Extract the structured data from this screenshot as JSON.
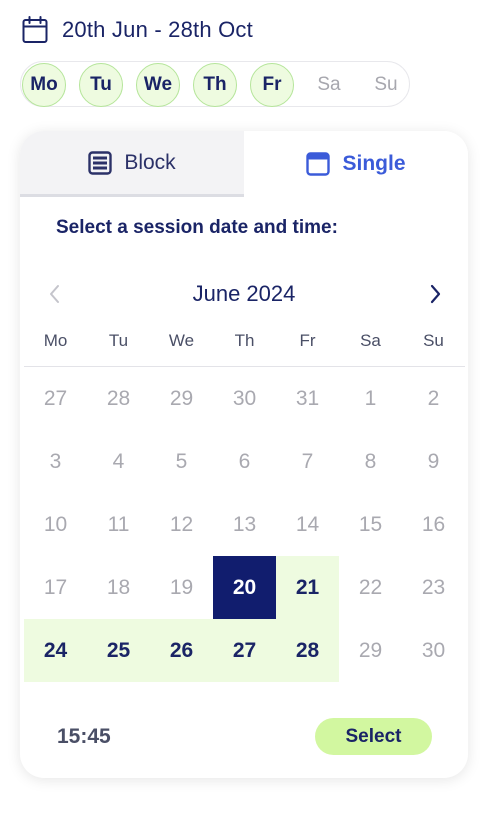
{
  "header": {
    "date_range": "20th Jun - 28th Oct",
    "icon": "calendar-icon"
  },
  "weekday_filter": [
    {
      "label": "Mo",
      "active": true
    },
    {
      "label": "Tu",
      "active": true
    },
    {
      "label": "We",
      "active": true
    },
    {
      "label": "Th",
      "active": true
    },
    {
      "label": "Fr",
      "active": true
    },
    {
      "label": "Sa",
      "active": false
    },
    {
      "label": "Su",
      "active": false
    }
  ],
  "tabs": {
    "block": {
      "label": "Block",
      "icon": "block-list-icon"
    },
    "single": {
      "label": "Single",
      "icon": "single-window-icon",
      "selected": true
    }
  },
  "instruction": "Select a session date and time:",
  "calendar": {
    "month": "June 2024",
    "weekdays": [
      "Mo",
      "Tu",
      "We",
      "Th",
      "Fr",
      "Sa",
      "Su"
    ],
    "weeks": [
      [
        {
          "d": "27",
          "s": "muted"
        },
        {
          "d": "28",
          "s": "muted"
        },
        {
          "d": "29",
          "s": "muted"
        },
        {
          "d": "30",
          "s": "muted"
        },
        {
          "d": "31",
          "s": "muted"
        },
        {
          "d": "1",
          "s": "muted"
        },
        {
          "d": "2",
          "s": "muted"
        }
      ],
      [
        {
          "d": "3",
          "s": "muted"
        },
        {
          "d": "4",
          "s": "muted"
        },
        {
          "d": "5",
          "s": "muted"
        },
        {
          "d": "6",
          "s": "muted"
        },
        {
          "d": "7",
          "s": "muted"
        },
        {
          "d": "8",
          "s": "muted"
        },
        {
          "d": "9",
          "s": "muted"
        }
      ],
      [
        {
          "d": "10",
          "s": "muted"
        },
        {
          "d": "11",
          "s": "muted"
        },
        {
          "d": "12",
          "s": "muted"
        },
        {
          "d": "13",
          "s": "muted"
        },
        {
          "d": "14",
          "s": "muted"
        },
        {
          "d": "15",
          "s": "muted"
        },
        {
          "d": "16",
          "s": "muted"
        }
      ],
      [
        {
          "d": "17",
          "s": "muted"
        },
        {
          "d": "18",
          "s": "muted"
        },
        {
          "d": "19",
          "s": "muted"
        },
        {
          "d": "20",
          "s": "selected"
        },
        {
          "d": "21",
          "s": "available"
        },
        {
          "d": "22",
          "s": "muted"
        },
        {
          "d": "23",
          "s": "muted"
        }
      ],
      [
        {
          "d": "24",
          "s": "available"
        },
        {
          "d": "25",
          "s": "available"
        },
        {
          "d": "26",
          "s": "available"
        },
        {
          "d": "27",
          "s": "available"
        },
        {
          "d": "28",
          "s": "available"
        },
        {
          "d": "29",
          "s": "muted"
        },
        {
          "d": "30",
          "s": "muted"
        }
      ]
    ]
  },
  "footer": {
    "time": "15:45",
    "select_label": "Select"
  },
  "colors": {
    "navy": "#1a2466",
    "selected_day": "#111d6e",
    "available_day_bg": "#eefbe0",
    "accent_blue": "#3b5bd9",
    "select_button": "#d2f7a0"
  }
}
